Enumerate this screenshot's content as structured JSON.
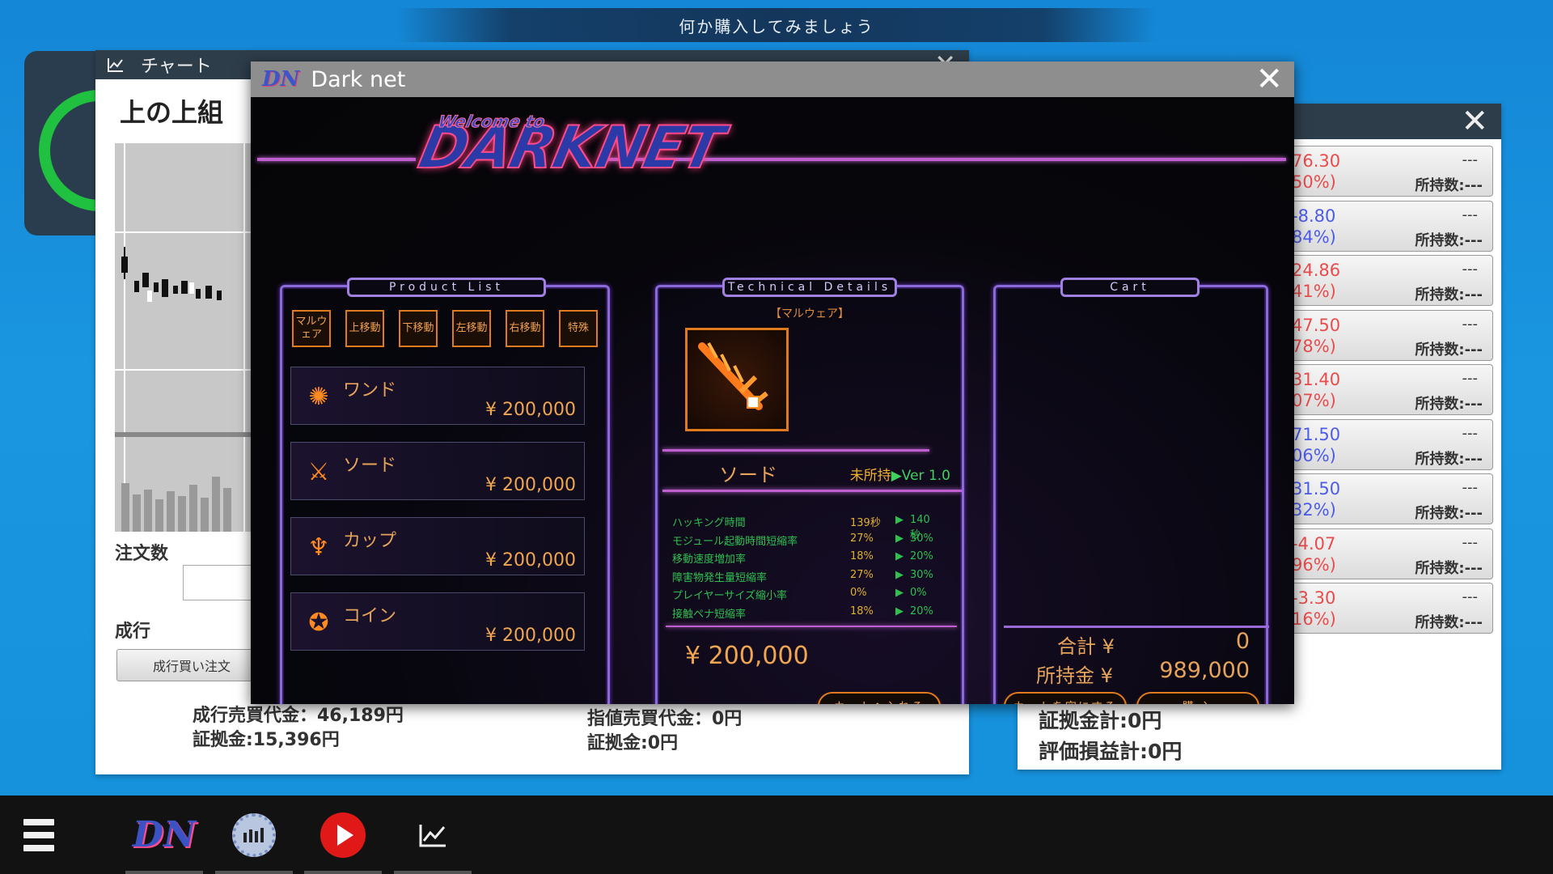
{
  "banner": {
    "text": "何か購入してみましょう"
  },
  "chart_window": {
    "title": "チャート",
    "title_icon": "chart-line-icon",
    "stock_name": "上の上組",
    "order_qty_label": "注文数",
    "market_label": "成行",
    "market_buy_button": "成行買い注文",
    "summary_left": [
      "成行売買代金：46,189円",
      "証拠金:15,396円"
    ],
    "summary_mid": [
      "指値売買代金：0円",
      "証拠金:0円"
    ]
  },
  "positions_window": {
    "rows": [
      {
        "price": "76.30",
        "pct": "50%)",
        "color": "#e84c4c",
        "dash": "---",
        "held": "所持数:---"
      },
      {
        "price": "-8.80",
        "pct": "84%)",
        "color": "#4c5ce8",
        "dash": "---",
        "held": "所持数:---"
      },
      {
        "price": "24.86",
        "pct": "41%)",
        "color": "#e84c4c",
        "dash": "---",
        "held": "所持数:---"
      },
      {
        "price": "47.50",
        "pct": "78%)",
        "color": "#e84c4c",
        "dash": "---",
        "held": "所持数:---"
      },
      {
        "price": "31.40",
        "pct": "07%)",
        "color": "#e84c4c",
        "dash": "---",
        "held": "所持数:---"
      },
      {
        "price": "71.50",
        "pct": "06%)",
        "color": "#4c5ce8",
        "dash": "---",
        "held": "所持数:---"
      },
      {
        "price": "31.50",
        "pct": "32%)",
        "color": "#4c5ce8",
        "dash": "---",
        "held": "所持数:---"
      },
      {
        "price": "-4.07",
        "pct": "96%)",
        "color": "#e84c4c",
        "dash": "---",
        "held": "所持数:---"
      },
      {
        "price": "-3.30",
        "pct": "16%)",
        "color": "#e84c4c",
        "dash": "---",
        "held": "所持数:---"
      }
    ],
    "summary": [
      "証拠金計:0円",
      "評価損益計:0円"
    ]
  },
  "darknet": {
    "window_title": "Dark net",
    "logo_small": "DN",
    "logo_main": "DARKNET",
    "logo_welcome": "Welcome to",
    "product_list_label": "Product List",
    "technical_label": "Technical Details",
    "cart_label": "Cart",
    "categories": [
      "マルウェア",
      "上移動",
      "下移動",
      "左移動",
      "右移動",
      "特殊"
    ],
    "products": [
      {
        "name": "ワンド",
        "price": "¥ 200,000",
        "icon": "wand-icon",
        "glyph": "✺"
      },
      {
        "name": "ソード",
        "price": "¥ 200,000",
        "icon": "sword-icon",
        "glyph": "⚔"
      },
      {
        "name": "カップ",
        "price": "¥ 200,000",
        "icon": "cup-icon",
        "glyph": "♆"
      },
      {
        "name": "コイン",
        "price": "¥ 200,000",
        "icon": "coin-icon",
        "glyph": "✪"
      }
    ],
    "detail": {
      "category": "【マルウェア】",
      "name": "ソード",
      "status": "未所持",
      "version": "▶Ver 1.0",
      "stats": [
        {
          "name": "ハッキング時間",
          "cur": "139秒",
          "new": "140秒"
        },
        {
          "name": "モジュール起動時間短縮率",
          "cur": "27%",
          "new": "30%"
        },
        {
          "name": "移動速度増加率",
          "cur": "18%",
          "new": "20%"
        },
        {
          "name": "障害物発生量短縮率",
          "cur": "27%",
          "new": "30%"
        },
        {
          "name": "プレイヤーサイズ縮小率",
          "cur": "0%",
          "new": "0%"
        },
        {
          "name": "接触ペナ短縮率",
          "cur": "18%",
          "new": "20%"
        }
      ],
      "price": "¥ 200,000",
      "add_to_cart": "カートへ入れる"
    },
    "cart": {
      "total_label": "合計 ¥",
      "total_value": "0",
      "money_label": "所持金 ¥",
      "money_value": "989,000",
      "empty_button": "カートを空にする",
      "buy_button": "購 入"
    }
  },
  "taskbar": {
    "items": [
      "menu-icon",
      "darknet-icon",
      "settings-gear-icon",
      "play-icon",
      "chart-icon"
    ],
    "darknet_label": "DN"
  }
}
